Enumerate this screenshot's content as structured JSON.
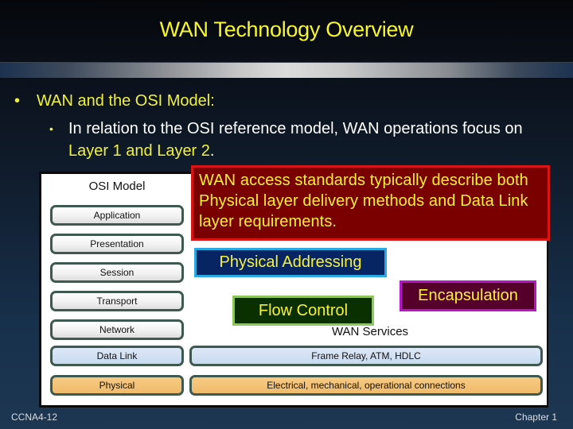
{
  "slide": {
    "title": "WAN Technology Overview",
    "bullets": {
      "level1_marker": "•",
      "level1": "WAN and the OSI Model:",
      "level2_marker": "•",
      "level2_text_plain": "In relation to the OSI reference model, WAN operations focus on ",
      "level2_text_highlight": "Layer 1 and Layer 2",
      "level2_text_end": "."
    },
    "diagram": {
      "osi_title": "OSI Model",
      "layers": [
        "Application",
        "Presentation",
        "Session",
        "Transport",
        "Network",
        "Data Link",
        "Physical"
      ],
      "wan_services_label": "WAN Services",
      "wan_data_link": "Frame Relay, ATM, HDLC",
      "wan_physical": "Electrical, mechanical, operational connections"
    },
    "callouts": {
      "standards": "WAN access standards typically describe both Physical layer delivery methods and Data Link layer requirements.",
      "physical_addressing": "Physical Addressing",
      "flow_control": "Flow Control",
      "encapsulation": "Encapsulation"
    },
    "footer": {
      "left": "CCNA4-12",
      "right": "Chapter 1"
    },
    "colors": {
      "title_yellow": "#f7f72e",
      "callout_red_bg": "#7a0000",
      "callout_red_border": "#d81414",
      "phys_addr_bg": "#072562",
      "phys_addr_border": "#29a8e4",
      "flow_bg": "#0b3000",
      "flow_border": "#8ec85b",
      "encap_bg": "#55002a",
      "encap_border": "#b516c8",
      "data_link_fill": "#c9daf0",
      "physical_fill": "#efbb6c"
    }
  }
}
